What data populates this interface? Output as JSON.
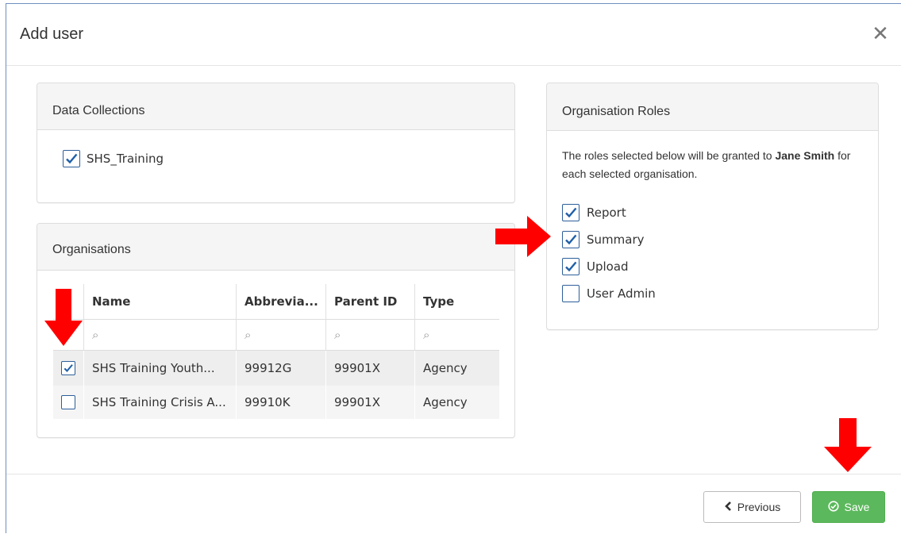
{
  "modal": {
    "title": "Add user",
    "close_glyph": "✕"
  },
  "data_collections": {
    "title": "Data Collections",
    "items": [
      {
        "label": "SHS_Training",
        "checked": true
      }
    ]
  },
  "organisations": {
    "title": "Organisations",
    "columns": [
      "Name",
      "Abbrevia...",
      "Parent ID",
      "Type"
    ],
    "rows": [
      {
        "checked": true,
        "name": "SHS Training Youth...",
        "abbreviation": "99912G",
        "parent_id": "99901X",
        "type": "Agency"
      },
      {
        "checked": false,
        "name": "SHS Training Crisis A...",
        "abbreviation": "99910K",
        "parent_id": "99901X",
        "type": "Agency"
      }
    ]
  },
  "roles": {
    "title": "Organisation Roles",
    "desc_prefix": "The roles selected below will be granted to",
    "user_name": "Jane Smith",
    "desc_suffix": "for each selected organisation.",
    "items": [
      {
        "label": "Report",
        "checked": true
      },
      {
        "label": "Summary",
        "checked": true
      },
      {
        "label": "Upload",
        "checked": true
      },
      {
        "label": "User Admin",
        "checked": false
      }
    ]
  },
  "footer": {
    "previous_label": "Previous",
    "save_label": "Save"
  },
  "colors": {
    "checkbox_border": "#2d5f9a",
    "save_green": "#5cb85c",
    "arrow_red": "#ff0000"
  }
}
